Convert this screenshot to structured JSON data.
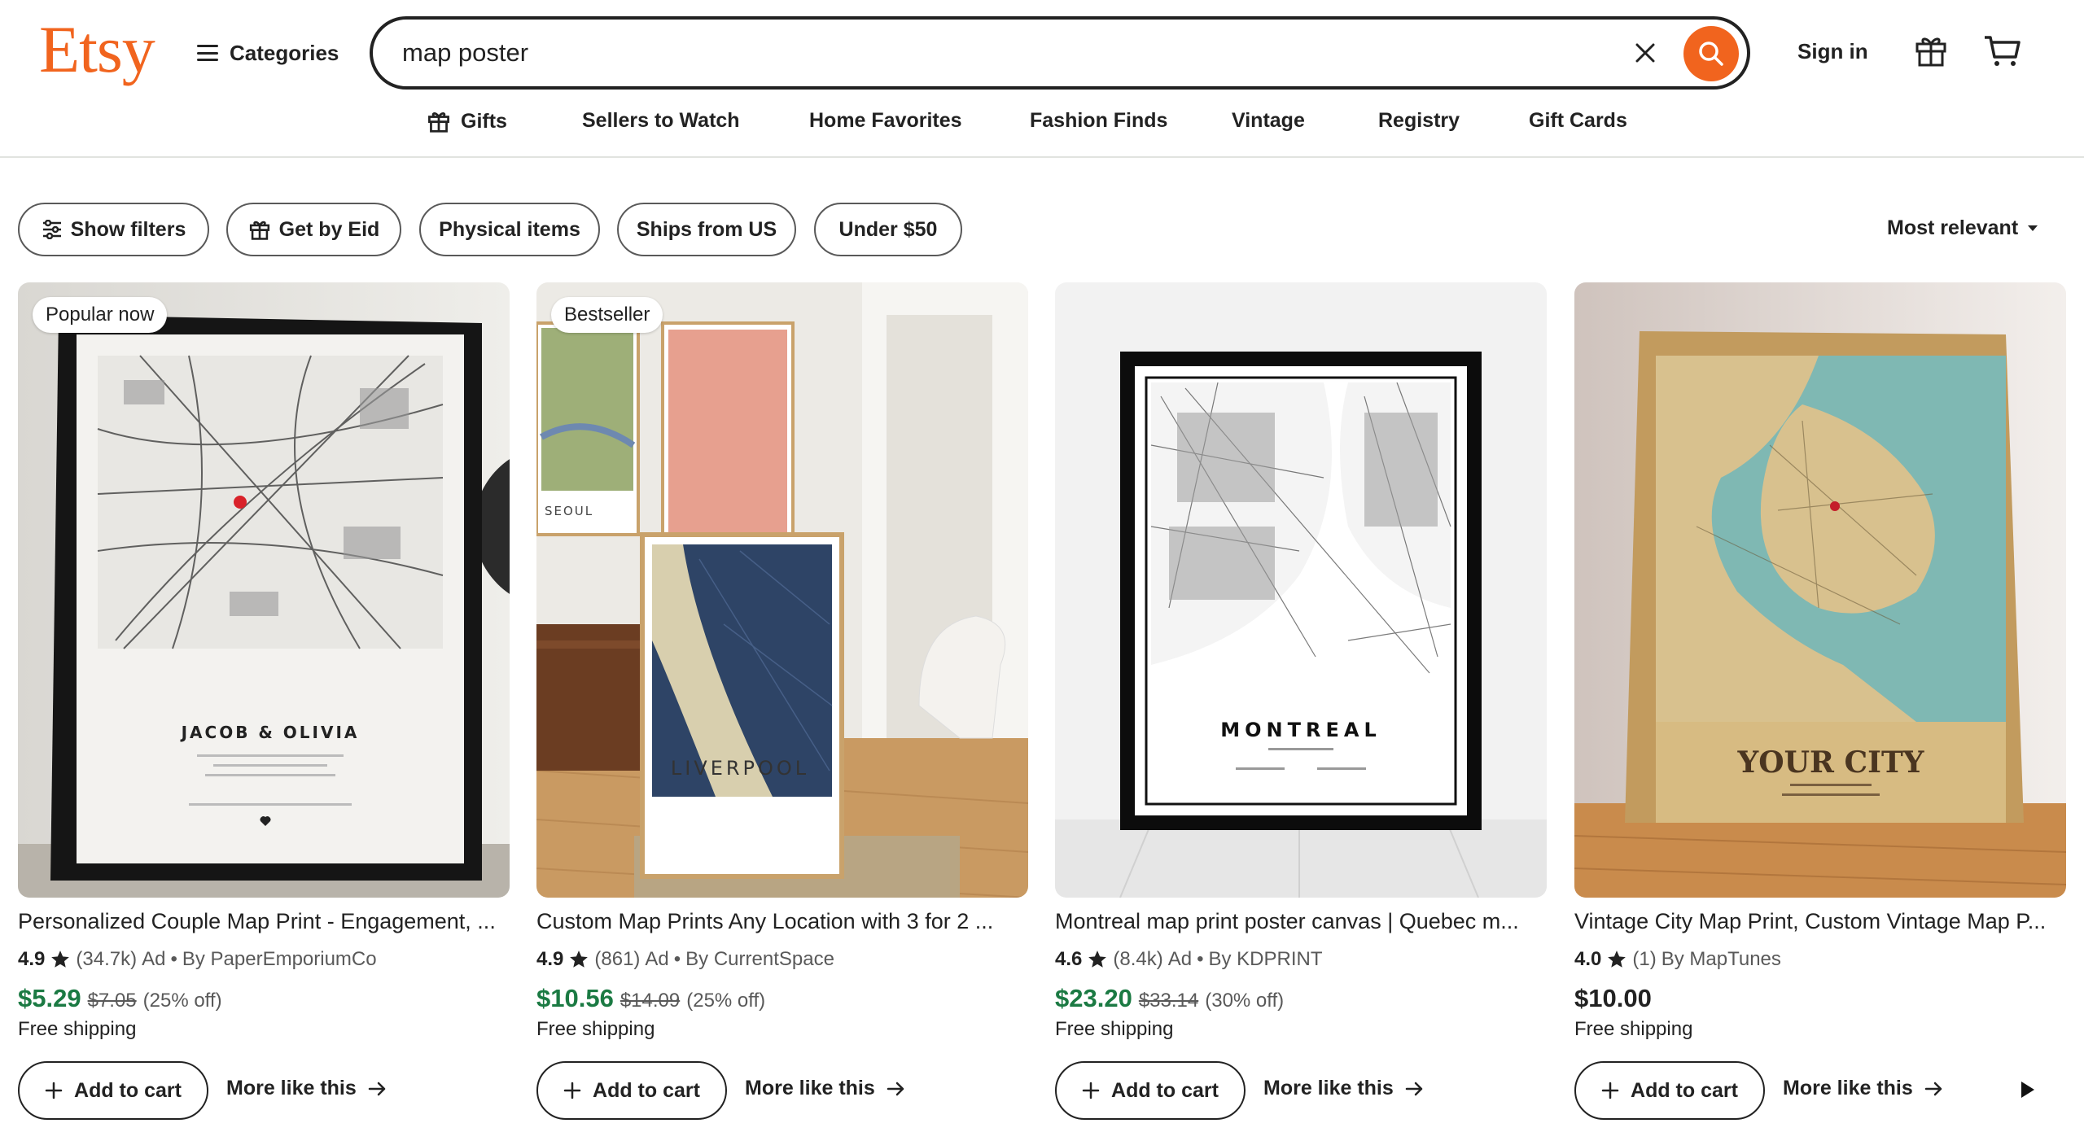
{
  "header": {
    "logo": "Etsy",
    "categories_label": "Categories",
    "search_value": "map poster",
    "signin_label": "Sign in"
  },
  "nav": [
    {
      "label": "Gifts",
      "icon": "gift-icon"
    },
    {
      "label": "Sellers to Watch"
    },
    {
      "label": "Home Favorites"
    },
    {
      "label": "Fashion Finds"
    },
    {
      "label": "Vintage"
    },
    {
      "label": "Registry"
    },
    {
      "label": "Gift Cards"
    }
  ],
  "filters": {
    "chips": [
      "Show filters",
      "Get by Eid",
      "Physical items",
      "Ships from US",
      "Under $50"
    ],
    "sort_label": "Most relevant"
  },
  "colors": {
    "brand": "#f1641e",
    "price_sale": "#1b7a43",
    "text": "#222222",
    "muted": "#595959"
  },
  "products": [
    {
      "badge": "Popular now",
      "image_caption": "JACOB & OLIVIA",
      "title": "Personalized Couple Map Print - Engagement, ...",
      "rating": "4.9",
      "reviews": "(34.7k)",
      "ad": "Ad",
      "seller": "By PaperEmporiumCo",
      "price": "$5.29",
      "original_price": "$7.05",
      "discount": "(25% off)",
      "shipping": "Free shipping",
      "add_label": "Add to cart",
      "more_label": "More like this"
    },
    {
      "badge": "Bestseller",
      "image_caption": "LIVERPOOL",
      "title": "Custom Map Prints Any Location with 3 for 2 ...",
      "rating": "4.9",
      "reviews": "(861)",
      "ad": "Ad",
      "seller": "By CurrentSpace",
      "price": "$10.56",
      "original_price": "$14.09",
      "discount": "(25% off)",
      "shipping": "Free shipping",
      "add_label": "Add to cart",
      "more_label": "More like this"
    },
    {
      "badge": "",
      "image_caption": "MONTREAL",
      "title": "Montreal map print poster canvas | Quebec m...",
      "rating": "4.6",
      "reviews": "(8.4k)",
      "ad": "Ad",
      "seller": "By KDPRINT",
      "price": "$23.20",
      "original_price": "$33.14",
      "discount": "(30% off)",
      "shipping": "Free shipping",
      "add_label": "Add to cart",
      "more_label": "More like this"
    },
    {
      "badge": "",
      "image_caption": "YOUR CITY",
      "title": "Vintage City Map Print, Custom Vintage Map P...",
      "rating": "4.0",
      "reviews": "(1)",
      "ad": "",
      "seller": "By MapTunes",
      "price": "$10.00",
      "original_price": "",
      "discount": "",
      "shipping": "Free shipping",
      "add_label": "Add to cart",
      "more_label": "More like this"
    }
  ]
}
